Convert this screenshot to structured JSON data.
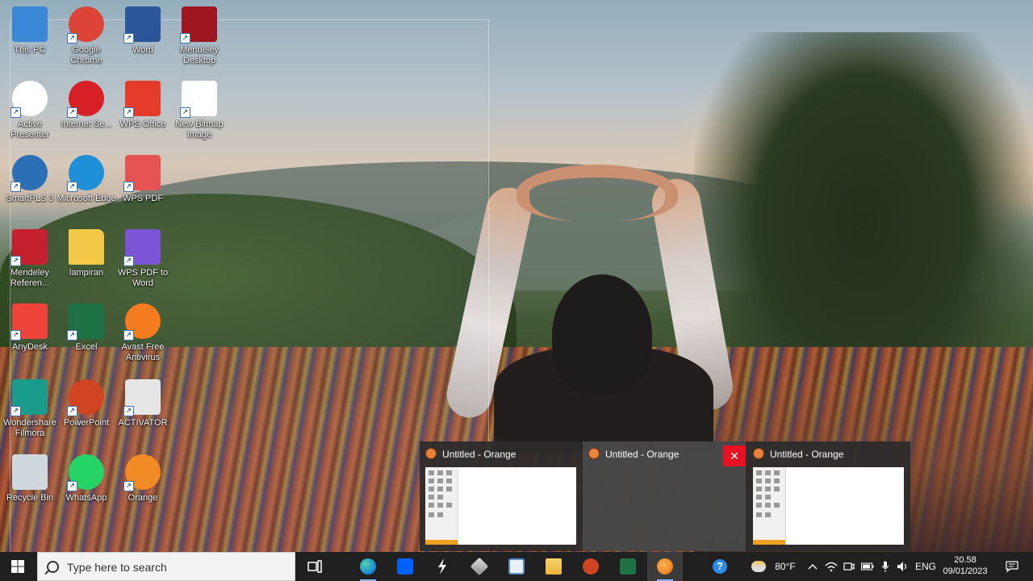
{
  "desktop": {
    "icons": [
      {
        "label": "This PC",
        "icon": "this-pc-icon",
        "color": "#3a87d6"
      },
      {
        "label": "Google Chrome",
        "icon": "chrome-icon",
        "color": "#db4437"
      },
      {
        "label": "Word",
        "icon": "word-icon",
        "color": "#2b579a"
      },
      {
        "label": "Mendeley Desktop",
        "icon": "mendeley-icon",
        "color": "#9d1620"
      },
      {
        "label": "Active Presenter",
        "icon": "active-presenter-icon",
        "color": "#ffffff"
      },
      {
        "label": "Internet Se...",
        "icon": "internet-security-icon",
        "color": "#d71f26"
      },
      {
        "label": "WPS Office",
        "icon": "wps-office-icon",
        "color": "#e53b2b"
      },
      {
        "label": "New Bitmap Image",
        "icon": "bitmap-file-icon",
        "color": "#ffffff"
      },
      {
        "label": "SmartPLS 3",
        "icon": "smartpls-icon",
        "color": "#2b6fb6"
      },
      {
        "label": "Microsoft Edge",
        "icon": "edge-icon",
        "color": "#1f8fd8"
      },
      {
        "label": "WPS PDF",
        "icon": "wps-pdf-icon",
        "color": "#e55353"
      },
      {
        "label": "Mendeley Referen...",
        "icon": "mendeley-reference-icon",
        "color": "#c4202e"
      },
      {
        "label": "lampiran",
        "icon": "folder-icon",
        "color": "#f3c94a"
      },
      {
        "label": "WPS PDF to Word",
        "icon": "wps-pdf-to-word-icon",
        "color": "#7a55d6"
      },
      {
        "label": "AnyDesk",
        "icon": "anydesk-icon",
        "color": "#ef443b"
      },
      {
        "label": "Excel",
        "icon": "excel-icon",
        "color": "#1e7145"
      },
      {
        "label": "Avast Free Antivirus",
        "icon": "avast-icon",
        "color": "#f57c20"
      },
      {
        "label": "Wondershare Filmora",
        "icon": "filmora-icon",
        "color": "#1a9c8c"
      },
      {
        "label": "PowerPoint",
        "icon": "powerpoint-icon",
        "color": "#d04423"
      },
      {
        "label": "ACTIVATOR",
        "icon": "activator-icon",
        "color": "#e6e6e6"
      },
      {
        "label": "Recycle Bin",
        "icon": "recycle-bin-icon",
        "color": "#cfd8dc"
      },
      {
        "label": "WhatsApp",
        "icon": "whatsapp-icon",
        "color": "#25d366"
      },
      {
        "label": "Orange",
        "icon": "orange-app-icon",
        "color": "#f08a24"
      }
    ]
  },
  "thumbnails": [
    {
      "title": "Untitled  - Orange",
      "icon": "orange-app-icon"
    },
    {
      "title": "Untitled  - Orange",
      "icon": "orange-app-icon",
      "close": "✕"
    },
    {
      "title": "Untitled  - Orange",
      "icon": "orange-app-icon"
    }
  ],
  "taskbar": {
    "search_placeholder": "Type here to search",
    "apps": [
      "task-view-icon",
      "edge-icon",
      "dropbox-icon",
      "winamp-icon",
      "inkscape-icon",
      "notepad-icon",
      "file-explorer-icon",
      "powerpoint-icon",
      "excel-icon",
      "orange-app-icon"
    ],
    "tray": {
      "temperature": "80°F",
      "language": "ENG",
      "time": "20.58",
      "date": "09/01/2023"
    }
  }
}
